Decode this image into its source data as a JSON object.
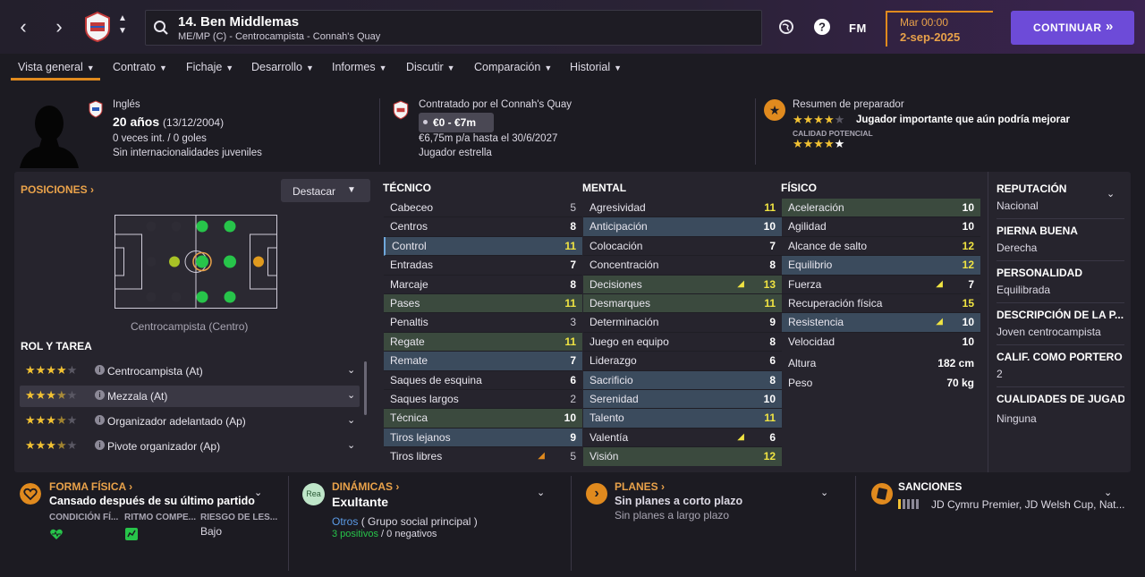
{
  "topbar": {
    "back_icon": "chevron-left-icon",
    "forward_icon": "chevron-right-icon",
    "player_title": "14. Ben Middlemas",
    "player_subtitle": "ME/MP (C) - Centrocampista - Connah's Quay",
    "fm_label": "FM",
    "date_line1": "Mar 00:00",
    "date_line2": "2-sep-2025",
    "continue_label": "CONTINUAR"
  },
  "tabs": [
    {
      "label": "Vista general"
    },
    {
      "label": "Contrato"
    },
    {
      "label": "Fichaje"
    },
    {
      "label": "Desarrollo"
    },
    {
      "label": "Informes"
    },
    {
      "label": "Discutir"
    },
    {
      "label": "Comparación"
    },
    {
      "label": "Historial"
    }
  ],
  "info": {
    "nationality": "Inglés",
    "age": "20 años",
    "dob": "(13/12/2004)",
    "caps": "0 veces int. / 0 goles",
    "youth": "Sin internacionalidades juveniles",
    "contracted": "Contratado por el Connah's Quay",
    "value": "€0 - €7m",
    "wage": "€6,75m p/a hasta el 30/6/2027",
    "status": "Jugador estrella",
    "coach_summary_title": "Resumen de preparador",
    "coach_summary": "Jugador importante que aún podría mejorar",
    "current_ability_stars": 4,
    "potential_label": "CALIDAD POTENCIAL",
    "potential_stars": 4.5
  },
  "positions": {
    "title": "POSICIONES",
    "dropdown": "Destacar",
    "pitch_label": "Centrocampista (Centro)"
  },
  "roles": {
    "title": "ROL Y TAREA",
    "items": [
      {
        "label": "Centrocampista (At)",
        "stars": 4
      },
      {
        "label": "Mezzala (At)",
        "stars": 3.5
      },
      {
        "label": "Organizador adelantado (Ap)",
        "stars": 3.5
      },
      {
        "label": "Pivote organizador (Ap)",
        "stars": 3.5
      }
    ]
  },
  "attributes": {
    "technical_title": "TÉCNICO",
    "mental_title": "MENTAL",
    "physical_title": "FÍSICO",
    "technical": [
      {
        "name": "Cabeceo",
        "value": "5"
      },
      {
        "name": "Centros",
        "value": "8"
      },
      {
        "name": "Control",
        "value": "11"
      },
      {
        "name": "Entradas",
        "value": "7"
      },
      {
        "name": "Marcaje",
        "value": "8"
      },
      {
        "name": "Pases",
        "value": "11"
      },
      {
        "name": "Penaltis",
        "value": "3"
      },
      {
        "name": "Regate",
        "value": "11"
      },
      {
        "name": "Remate",
        "value": "7"
      },
      {
        "name": "Saques de esquina",
        "value": "6"
      },
      {
        "name": "Saques largos",
        "value": "2"
      },
      {
        "name": "Técnica",
        "value": "10"
      },
      {
        "name": "Tiros lejanos",
        "value": "9"
      },
      {
        "name": "Tiros libres",
        "value": "5"
      }
    ],
    "mental": [
      {
        "name": "Agresividad",
        "value": "11"
      },
      {
        "name": "Anticipación",
        "value": "10"
      },
      {
        "name": "Colocación",
        "value": "7"
      },
      {
        "name": "Concentración",
        "value": "8"
      },
      {
        "name": "Decisiones",
        "value": "13"
      },
      {
        "name": "Desmarques",
        "value": "11"
      },
      {
        "name": "Determinación",
        "value": "9"
      },
      {
        "name": "Juego en equipo",
        "value": "8"
      },
      {
        "name": "Liderazgo",
        "value": "6"
      },
      {
        "name": "Sacrificio",
        "value": "8"
      },
      {
        "name": "Serenidad",
        "value": "10"
      },
      {
        "name": "Talento",
        "value": "11"
      },
      {
        "name": "Valentía",
        "value": "6"
      },
      {
        "name": "Visión",
        "value": "12"
      }
    ],
    "physical": [
      {
        "name": "Aceleración",
        "value": "10"
      },
      {
        "name": "Agilidad",
        "value": "10"
      },
      {
        "name": "Alcance de salto",
        "value": "12"
      },
      {
        "name": "Equilibrio",
        "value": "12"
      },
      {
        "name": "Fuerza",
        "value": "7"
      },
      {
        "name": "Recuperación física",
        "value": "15"
      },
      {
        "name": "Resistencia",
        "value": "10"
      },
      {
        "name": "Velocidad",
        "value": "10"
      }
    ],
    "height_label": "Altura",
    "height": "182 cm",
    "weight_label": "Peso",
    "weight": "70 kg"
  },
  "side": {
    "reputation_title": "REPUTACIÓN",
    "reputation": "Nacional",
    "foot_title": "PIERNA BUENA",
    "foot": "Derecha",
    "personality_title": "PERSONALIDAD",
    "personality": "Equilibrada",
    "description_title": "DESCRIPCIÓN DE LA P...",
    "description": "Joven centrocampista",
    "gk_title": "CALIF. COMO PORTERO",
    "gk": "2",
    "qualities_title": "CUALIDADES DE JUGADO",
    "qualities": "Ninguna"
  },
  "bottom": {
    "fitness_title": "FORMA FÍSICA",
    "fitness_main": "Cansado después de su último partido",
    "fitness_col1": "CONDICIÓN FÍ...",
    "fitness_col2": "RITMO COMPE...",
    "fitness_col3": "RIESGO DE LES...",
    "fitness_risk": "Bajo",
    "dynamics_badge": "Rea",
    "dynamics_title": "DINÁMICAS",
    "dynamics_main": "Exultante",
    "dynamics_group_link": "Otros",
    "dynamics_group": "( Grupo social principal )",
    "dynamics_positive": "3 positivos",
    "dynamics_sep": "/",
    "dynamics_negative": "0 negativos",
    "plans_title": "PLANES",
    "plans_short": "Sin planes a corto plazo",
    "plans_long": "Sin planes a largo plazo",
    "sanctions_title": "SANCIONES",
    "sanctions_text": "JD Cymru Premier, JD Welsh Cup, Nat..."
  },
  "colors": {
    "accent": "#e08a1e",
    "primary_button": "#6d4bd8",
    "highlight_blue": "#3b4b5d",
    "highlight_green": "#3b4a3e",
    "value_yellow": "#f0e442"
  }
}
